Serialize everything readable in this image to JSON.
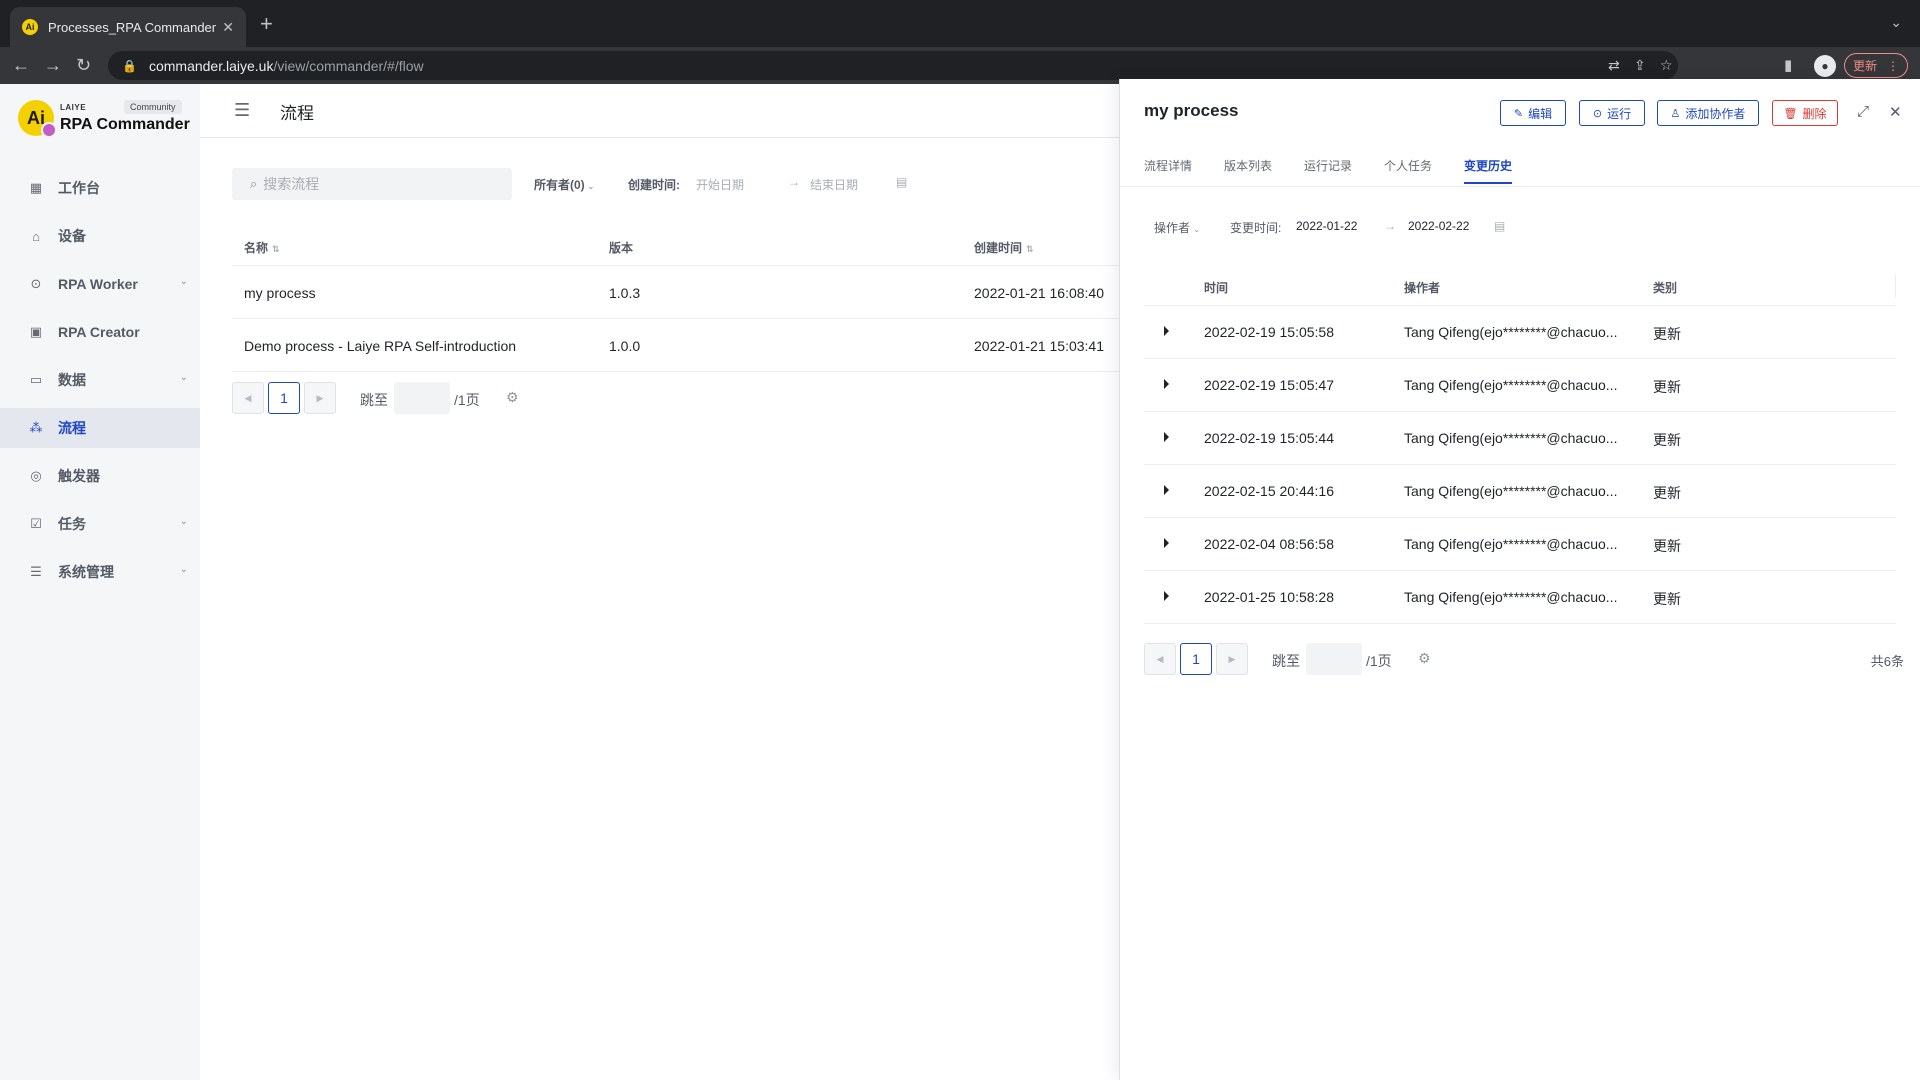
{
  "browser": {
    "tab_title": "Processes_RPA Commander",
    "favicon_text": "Ai",
    "new_tab_icon": "+",
    "url_host": "commander.laiye.uk",
    "url_path": "/view/commander/#/flow",
    "update_label": "更新"
  },
  "brand": {
    "logo_mark": "Ai",
    "small": "LAIYE",
    "badge": "Community",
    "name": "RPA Commander"
  },
  "sidebar": {
    "items": [
      {
        "label": "工作台",
        "icon": "dashboard-icon",
        "chevron": false,
        "active": false
      },
      {
        "label": "设备",
        "icon": "device-icon",
        "chevron": false,
        "active": false
      },
      {
        "label": "RPA Worker",
        "icon": "worker-icon",
        "chevron": true,
        "active": false
      },
      {
        "label": "RPA Creator",
        "icon": "creator-icon",
        "chevron": false,
        "active": false
      },
      {
        "label": "数据",
        "icon": "folder-icon",
        "chevron": true,
        "active": false
      },
      {
        "label": "流程",
        "icon": "flow-icon",
        "chevron": false,
        "active": true
      },
      {
        "label": "触发器",
        "icon": "trigger-icon",
        "chevron": false,
        "active": false
      },
      {
        "label": "任务",
        "icon": "task-icon",
        "chevron": true,
        "active": false
      },
      {
        "label": "系统管理",
        "icon": "system-icon",
        "chevron": true,
        "active": false
      }
    ]
  },
  "main": {
    "title": "流程",
    "search_placeholder": "搜索流程",
    "owner_filter": "所有者(0)",
    "created_label": "创建时间:",
    "start_date_placeholder": "开始日期",
    "end_date_placeholder": "结束日期",
    "columns": [
      "名称",
      "版本",
      "创建时间"
    ],
    "rows": [
      {
        "name": "my process",
        "version": "1.0.3",
        "created": "2022-01-21 16:08:40"
      },
      {
        "name": "Demo process - Laiye RPA Self-introduction",
        "version": "1.0.0",
        "created": "2022-01-21 15:03:41"
      }
    ],
    "pager": {
      "page": "1",
      "jump_label": "跳至",
      "pages_label": "/1页"
    }
  },
  "drawer": {
    "title": "my process",
    "buttons": {
      "edit": "编辑",
      "run": "运行",
      "add_collab": "添加协作者",
      "delete": "删除"
    },
    "tabs": [
      {
        "label": "流程详情",
        "active": false
      },
      {
        "label": "版本列表",
        "active": false
      },
      {
        "label": "运行记录",
        "active": false
      },
      {
        "label": "个人任务",
        "active": false
      },
      {
        "label": "变更历史",
        "active": true
      }
    ],
    "filter": {
      "operator_label": "操作者",
      "change_time_label": "变更时间:",
      "start": "2022-01-22",
      "end": "2022-02-22"
    },
    "columns": [
      "时间",
      "操作者",
      "类别"
    ],
    "rows": [
      {
        "time": "2022-02-19 15:05:58",
        "operator": "Tang Qifeng(ejo********@chacuo...",
        "category": "更新"
      },
      {
        "time": "2022-02-19 15:05:47",
        "operator": "Tang Qifeng(ejo********@chacuo...",
        "category": "更新"
      },
      {
        "time": "2022-02-19 15:05:44",
        "operator": "Tang Qifeng(ejo********@chacuo...",
        "category": "更新"
      },
      {
        "time": "2022-02-15 20:44:16",
        "operator": "Tang Qifeng(ejo********@chacuo...",
        "category": "更新"
      },
      {
        "time": "2022-02-04 08:56:58",
        "operator": "Tang Qifeng(ejo********@chacuo...",
        "category": "更新"
      },
      {
        "time": "2022-01-25 10:58:28",
        "operator": "Tang Qifeng(ejo********@chacuo...",
        "category": "更新"
      }
    ],
    "pager": {
      "page": "1",
      "jump_label": "跳至",
      "pages_label": "/1页",
      "total": "共6条"
    }
  },
  "colors": {
    "accent": "#1e47c5",
    "danger": "#d83931",
    "brand_yellow": "#f5d000"
  }
}
